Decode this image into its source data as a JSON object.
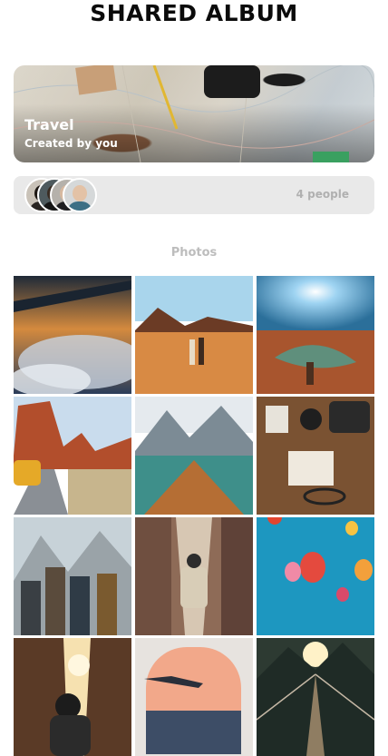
{
  "header": {
    "title": "SHARED ALBUM"
  },
  "album": {
    "name": "Travel",
    "subtitle": "Created by you"
  },
  "members": {
    "count_label": "4 people",
    "avatars": [
      "avatar-1",
      "avatar-2",
      "avatar-3",
      "avatar-4"
    ]
  },
  "photos": {
    "section_label": "Photos",
    "items": [
      "airplane-wing-clouds-photo",
      "desert-couple-photo",
      "canyon-sunburst-photo",
      "red-rocks-van-photo",
      "lake-boat-photo",
      "map-journal-camera-photo",
      "hikers-group-photo",
      "alley-backpacker-photo",
      "hot-air-balloons-photo",
      "canyon-sun-hat-photo",
      "airplane-window-photo",
      "suspension-bridge-photo"
    ]
  }
}
